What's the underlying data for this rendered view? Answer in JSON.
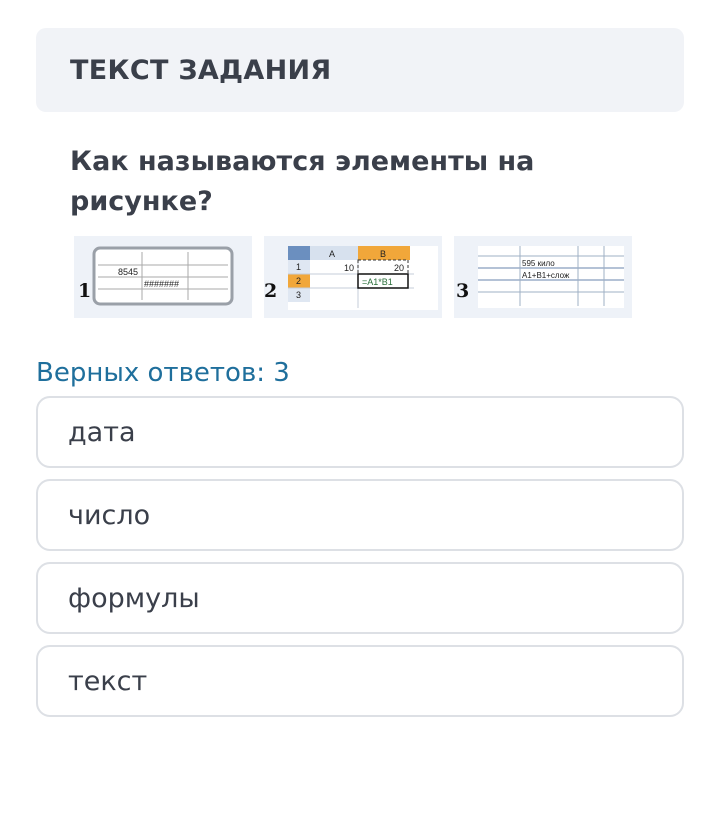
{
  "task_header": {
    "title": "ТЕКСТ ЗАДАНИЯ"
  },
  "question": {
    "text": "Как называются элементы на рисунке?"
  },
  "figures": [
    {
      "number": "1",
      "cells": {
        "top_value": "8545",
        "overflow": "#######"
      }
    },
    {
      "number": "2",
      "col_a": "A",
      "col_b": "B",
      "rows": [
        "1",
        "2",
        "3"
      ],
      "a1": "10",
      "b1": "20",
      "b2": "=A1*B1"
    },
    {
      "number": "3",
      "line1": "595 кило",
      "line2": "A1+B1+слож"
    }
  ],
  "answers": {
    "caption": "Верных ответов: 3",
    "options": [
      "дата",
      "число",
      "формулы",
      "текст"
    ]
  }
}
